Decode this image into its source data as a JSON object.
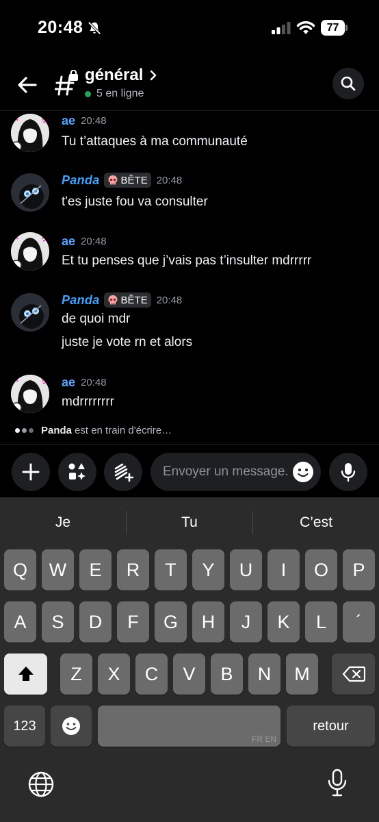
{
  "status_bar": {
    "time": "20:48",
    "battery": "77"
  },
  "header": {
    "channel_name": "général",
    "online": "5 en ligne"
  },
  "messages": [
    {
      "author": "ae",
      "role": "",
      "time": "20:48",
      "lines": [
        "Tu t’attaques à ma communauté"
      ]
    },
    {
      "author": "Panda",
      "role": "BÊTE",
      "time": "20:48",
      "lines": [
        "t'es juste fou va consulter"
      ]
    },
    {
      "author": "ae",
      "role": "",
      "time": "20:48",
      "lines": [
        "Et tu penses que j’vais pas t’insulter mdrrrrr"
      ]
    },
    {
      "author": "Panda",
      "role": "BÊTE",
      "time": "20:48",
      "lines": [
        "de quoi mdr",
        "juste je vote rn et alors"
      ]
    },
    {
      "author": "ae",
      "role": "",
      "time": "20:48",
      "lines": [
        "mdrrrrrrrr"
      ]
    }
  ],
  "typing": {
    "user": "Panda",
    "text": "est en train d'écrire…"
  },
  "composer": {
    "placeholder": "Envoyer un message..."
  },
  "keyboard": {
    "suggestions": [
      "Je",
      "Tu",
      "C’est"
    ],
    "row1": [
      "Q",
      "W",
      "E",
      "R",
      "T",
      "Y",
      "U",
      "I",
      "O",
      "P"
    ],
    "row2": [
      "A",
      "S",
      "D",
      "F",
      "G",
      "H",
      "J",
      "K",
      "L",
      "´"
    ],
    "row3": [
      "Z",
      "X",
      "C",
      "V",
      "B",
      "N",
      "M"
    ],
    "numbers_label": "123",
    "return_label": "retour",
    "space_hint": "FR EN"
  },
  "colors": {
    "background": "#000000",
    "author_ae": "#5aa6ff",
    "author_panda": "#3ea2ff",
    "online": "#23a55a",
    "keyboard_bg": "#2b2b2b",
    "key": "#6b6b6b"
  }
}
